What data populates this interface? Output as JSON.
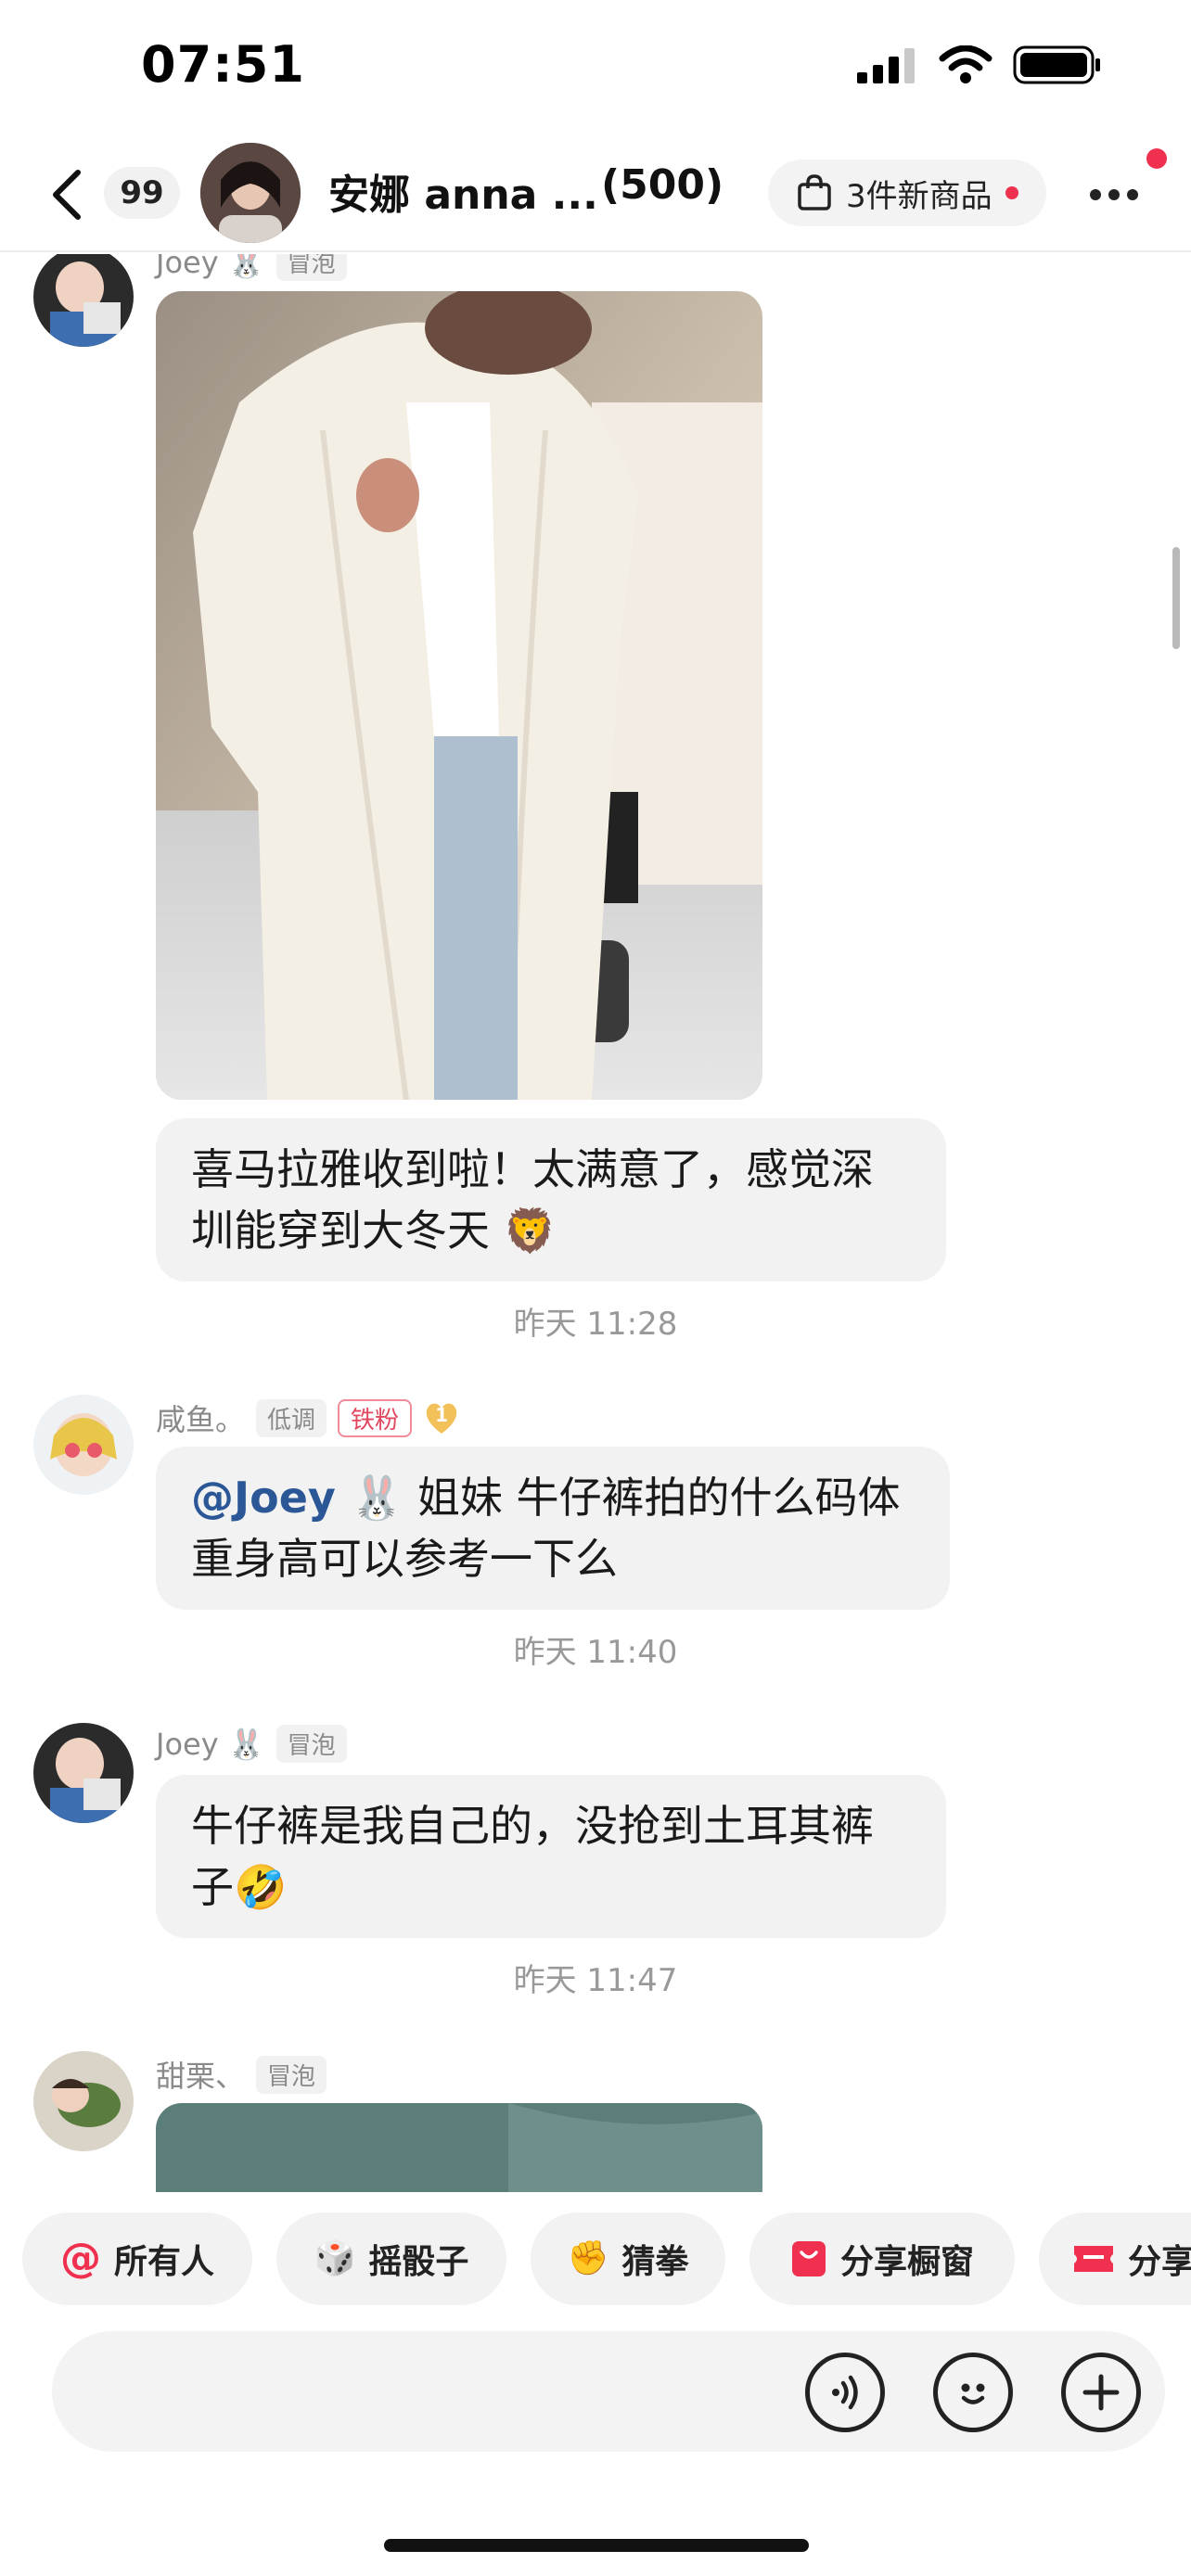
{
  "status_bar": {
    "time": "07:51"
  },
  "header": {
    "unread_count": "99",
    "group_name": "安娜 anna ...",
    "member_count": "(500)",
    "new_goods_label": "3件新商品"
  },
  "messages": [
    {
      "sender": "Joey 🐰",
      "tag": "冒泡",
      "text": "喜马拉雅收到啦！太满意了，感觉深圳能穿到大冬天 🦁",
      "time": "昨天 11:28"
    },
    {
      "sender": "咸鱼。",
      "tag": "低调",
      "fan_tag": "铁粉",
      "level": "1",
      "mention": "@Joey 🐰",
      "text": " 姐妹 牛仔裤拍的什么码体重身高可以参考一下么",
      "time": "昨天 11:40"
    },
    {
      "sender": "Joey 🐰",
      "tag": "冒泡",
      "text": "牛仔裤是我自己的，没抢到土耳其裤子🤣",
      "time": "昨天 11:47"
    },
    {
      "sender": "甜栗、",
      "tag": "冒泡"
    }
  ],
  "quick_actions": [
    {
      "icon": "@",
      "label": "所有人"
    },
    {
      "icon": "🎲",
      "label": "摇骰子"
    },
    {
      "icon": "✊",
      "label": "猜拳"
    },
    {
      "icon": "🔖",
      "label": "分享橱窗"
    },
    {
      "icon": "🎫",
      "label": "分享"
    }
  ],
  "input": {
    "placeholder": ""
  },
  "colors": {
    "accent_red": "#f0304f",
    "mention_blue": "#2b5797",
    "bubble_bg": "#f2f2f2"
  }
}
